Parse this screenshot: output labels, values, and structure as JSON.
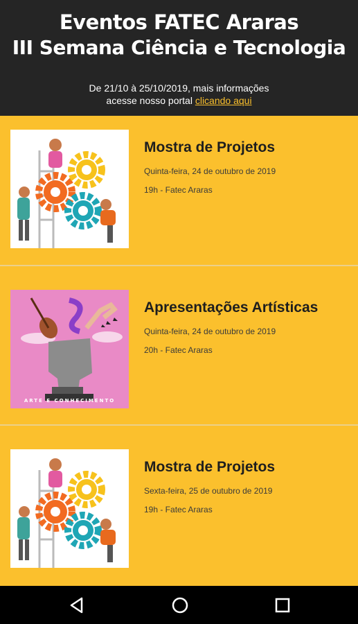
{
  "header": {
    "title_line1": "Eventos FATEC Araras",
    "title_line2": "III Semana Ciência e Tecnologia",
    "info_line1": "De 21/10 à 25/10/2019, mais informações",
    "info_line2_prefix": "acesse nosso portal ",
    "info_link": "clicando aqui",
    "link_color": "#fbc02d"
  },
  "events": [
    {
      "title": "Mostra de Projetos",
      "date": "Quinta-feira, 24 de outubro de 2019",
      "place": "19h - Fatec Araras",
      "image": "gears-teamwork-illustration"
    },
    {
      "title": "Apresentações Artísticas",
      "date": "Quinta-feira, 24 de outubro de 2019",
      "place": "20h - Fatec Araras",
      "image": "arte-e-conhecimento-illustration",
      "image_caption": "ARTE E CONHECIMENTO"
    },
    {
      "title": "Mostra de Projetos",
      "date": "Sexta-feira, 25 de outubro de 2019",
      "place": "19h - Fatec Araras",
      "image": "gears-teamwork-illustration"
    }
  ],
  "navbar": {
    "buttons": [
      "back-icon",
      "home-icon",
      "recents-icon"
    ]
  },
  "colors": {
    "background": "#fbc02d",
    "header": "#252525"
  }
}
